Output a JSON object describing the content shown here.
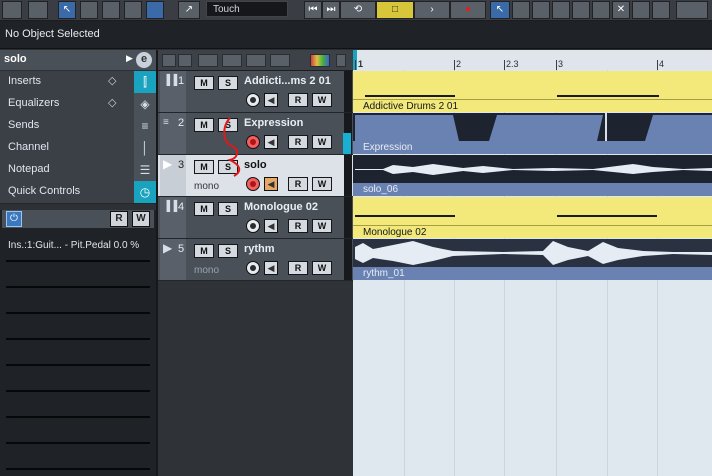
{
  "toolbar": {
    "automation_mode": "Touch"
  },
  "info_line": {
    "text": "No Object Selected"
  },
  "inspector": {
    "track_name": "solo",
    "edit_label": "e",
    "sections": [
      {
        "label": "Inserts",
        "icon": "fx-insert-icon"
      },
      {
        "label": "Equalizers",
        "icon": "eq-icon"
      },
      {
        "label": "Sends",
        "icon": "sends-icon"
      },
      {
        "label": "Channel",
        "icon": "channel-icon"
      },
      {
        "label": "Notepad",
        "icon": "notepad-icon"
      },
      {
        "label": "Quick Controls",
        "icon": "quick-controls-icon"
      }
    ],
    "quick_controls": {
      "read_label": "R",
      "write_label": "W",
      "slot1": "Ins.:1:Guit... - Pit.Pedal 0.0 %"
    }
  },
  "tracks": [
    {
      "number": "1",
      "name": "Addicti...ms 2 01",
      "mute": "M",
      "solo": "S",
      "read": "R",
      "write": "W",
      "subtitle": ""
    },
    {
      "number": "2",
      "name": "Expression",
      "mute": "M",
      "solo": "S",
      "read": "R",
      "write": "W",
      "subtitle": ""
    },
    {
      "number": "3",
      "name": "solo",
      "mute": "M",
      "solo": "S",
      "read": "R",
      "write": "W",
      "subtitle": "mono"
    },
    {
      "number": "4",
      "name": "Monologue 02",
      "mute": "M",
      "solo": "S",
      "read": "R",
      "write": "W",
      "subtitle": ""
    },
    {
      "number": "5",
      "name": "rythm",
      "mute": "M",
      "solo": "S",
      "read": "R",
      "write": "W",
      "subtitle": "mono"
    }
  ],
  "ruler": {
    "labels": [
      "1",
      "2",
      "2.3",
      "3",
      "4"
    ]
  },
  "parts": [
    {
      "label": "Addictive Drums 2 01",
      "style": "yellow"
    },
    {
      "label": "Expression",
      "style": "navy"
    },
    {
      "label": "solo_06",
      "style": "blueaudio"
    },
    {
      "label": "Monologue 02",
      "style": "yellow"
    },
    {
      "label": "rythm_01",
      "style": "blueaudio"
    }
  ]
}
